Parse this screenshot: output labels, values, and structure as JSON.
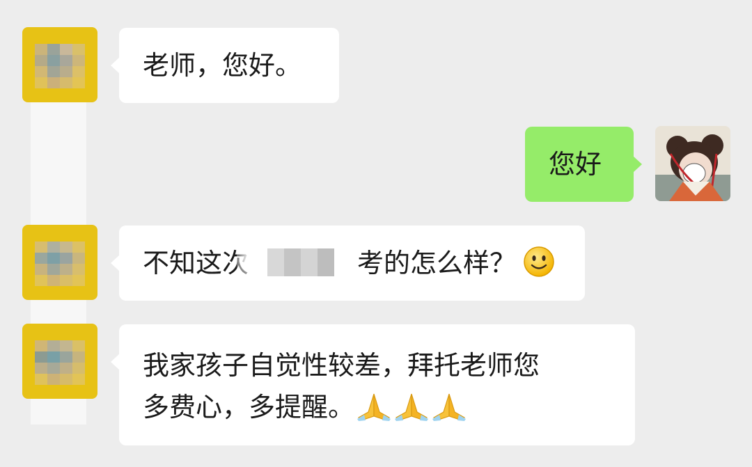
{
  "chat": {
    "messages": [
      {
        "side": "left",
        "text": "老师，您好。"
      },
      {
        "side": "right",
        "text": "您好"
      },
      {
        "side": "left",
        "text_before": "不知这次",
        "text_after": "考的怎么样？"
      },
      {
        "side": "left",
        "line1": "我家孩子自觉性较差，拜托老师您",
        "line2": "多费心，多提醒。"
      }
    ]
  },
  "icons": {
    "smile_emoji": "slightly-smiling-face",
    "hands_emoji": "folded-hands"
  },
  "colors": {
    "background": "#ededed",
    "incoming_bubble": "#ffffff",
    "outgoing_bubble": "#95ec69",
    "avatar_yellow": "#e7c215"
  }
}
